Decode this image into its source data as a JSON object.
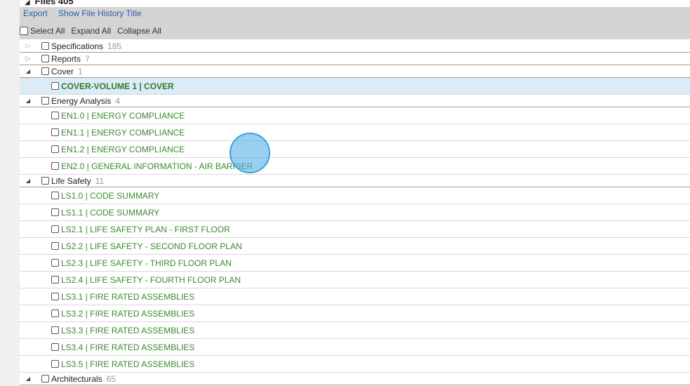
{
  "header": {
    "title": "Files 405"
  },
  "toolbar": {
    "export": "Export",
    "show_history": "Show File History Title",
    "select_all": "Select All",
    "expand_all": "Expand All",
    "collapse_all": "Collapse All"
  },
  "rows": [
    {
      "type": "group",
      "label": "Specifications",
      "count": "185",
      "expanded": false
    },
    {
      "type": "group",
      "label": "Reports",
      "count": "7",
      "expanded": false
    },
    {
      "type": "group",
      "label": "Cover",
      "count": "1",
      "expanded": true
    },
    {
      "type": "item",
      "label": "COVER-VOLUME 1 | COVER",
      "selected": true
    },
    {
      "type": "group",
      "label": "Energy Analysis",
      "count": "4",
      "expanded": true
    },
    {
      "type": "item",
      "label": "EN1.0 | ENERGY COMPLIANCE"
    },
    {
      "type": "item",
      "label": "EN1.1 | ENERGY COMPLIANCE"
    },
    {
      "type": "item",
      "label": "EN1.2 | ENERGY COMPLIANCE"
    },
    {
      "type": "item",
      "label": "EN2.0 | GENERAL INFORMATION - AIR BARRIER"
    },
    {
      "type": "group",
      "label": "Life Safety",
      "count": "11",
      "expanded": true
    },
    {
      "type": "item",
      "label": "LS1.0 | CODE SUMMARY"
    },
    {
      "type": "item",
      "label": "LS1.1 | CODE SUMMARY"
    },
    {
      "type": "item",
      "label": "LS2.1 | LIFE SAFETY PLAN - FIRST FLOOR"
    },
    {
      "type": "item",
      "label": "LS2.2 | LIFE SAFETY - SECOND FLOOR PLAN"
    },
    {
      "type": "item",
      "label": "LS2.3 | LIFE SAFETY - THIRD FLOOR PLAN"
    },
    {
      "type": "item",
      "label": "LS2.4 | LIFE SAFETY - FOURTH FLOOR PLAN"
    },
    {
      "type": "item",
      "label": "LS3.1 | FIRE RATED ASSEMBLIES"
    },
    {
      "type": "item",
      "label": "LS3.2 | FIRE RATED ASSEMBLIES"
    },
    {
      "type": "item",
      "label": "LS3.3 | FIRE RATED ASSEMBLIES"
    },
    {
      "type": "item",
      "label": "LS3.4 | FIRE RATED ASSEMBLIES"
    },
    {
      "type": "item",
      "label": "LS3.5 | FIRE RATED ASSEMBLIES"
    },
    {
      "type": "group",
      "label": "Architecturals",
      "count": "65",
      "expanded": true
    }
  ]
}
